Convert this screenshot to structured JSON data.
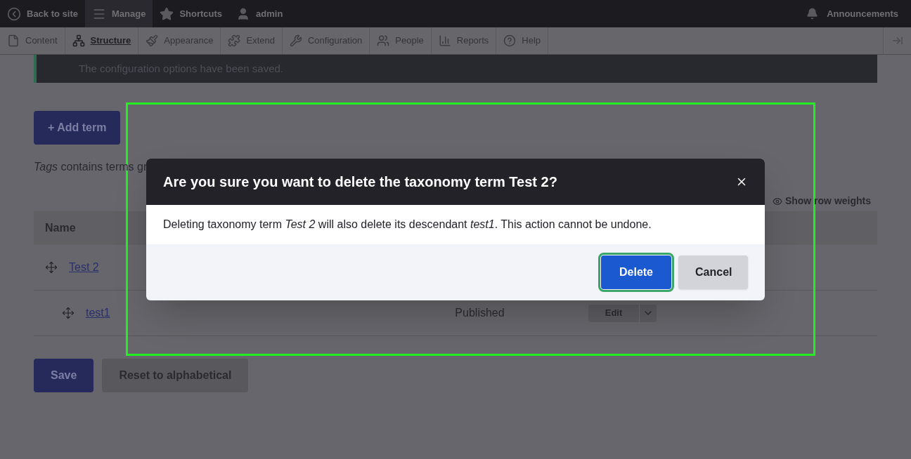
{
  "toolbar": {
    "items": [
      {
        "label": "Back to site",
        "selected": false
      },
      {
        "label": "Manage",
        "selected": true
      },
      {
        "label": "Shortcuts",
        "selected": false
      },
      {
        "label": "admin",
        "selected": false
      }
    ],
    "announcements": "Announcements"
  },
  "admin_menu": [
    {
      "label": "Content",
      "selected": false
    },
    {
      "label": "Structure",
      "selected": true
    },
    {
      "label": "Appearance",
      "selected": false
    },
    {
      "label": "Extend",
      "selected": false
    },
    {
      "label": "Configuration",
      "selected": false
    },
    {
      "label": "People",
      "selected": false
    },
    {
      "label": "Reports",
      "selected": false
    },
    {
      "label": "Help",
      "selected": false
    }
  ],
  "status_message": "The configuration options have been saved.",
  "add_term_button": "+ Add term",
  "description": "*Tags* contains terms gr",
  "show_row_weights": "Show row weights",
  "table": {
    "columns": [
      "Name"
    ],
    "rows": [
      {
        "name": "Test 2",
        "children": [
          {
            "name": "test1",
            "status": "Published",
            "operation": "Edit"
          }
        ]
      }
    ]
  },
  "form_buttons": [
    {
      "label": "Save",
      "kind": "primary"
    },
    {
      "label": "Reset to alphabetical",
      "kind": "secondary"
    }
  ],
  "dialog": {
    "title": "Are you sure you want to delete the taxonomy term Test 2?",
    "message": "Deleting taxonomy term *Test 2* will also delete its descendant *test1*. This action cannot be undone.",
    "buttons": [
      {
        "label": "Delete",
        "kind": "primary",
        "focused": true
      },
      {
        "label": "Cancel",
        "kind": "secondary",
        "focused": false
      }
    ]
  }
}
